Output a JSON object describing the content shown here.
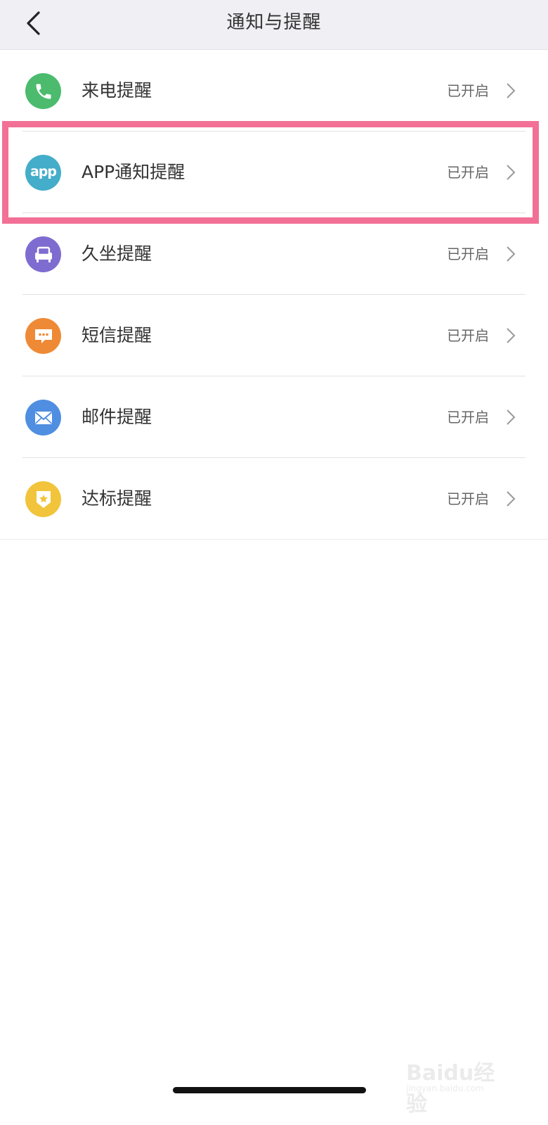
{
  "nav": {
    "title": "通知与提醒"
  },
  "rows": [
    {
      "label": "来电提醒",
      "status": "已开启",
      "icon": "phone-icon",
      "color": "#4cbb6e"
    },
    {
      "label": "APP通知提醒",
      "status": "已开启",
      "icon": "app-icon",
      "color": "#44adc9",
      "icon_text": "app"
    },
    {
      "label": "久坐提醒",
      "status": "已开启",
      "icon": "sofa-icon",
      "color": "#7f6cd1"
    },
    {
      "label": "短信提醒",
      "status": "已开启",
      "icon": "message-icon",
      "color": "#ee8a35"
    },
    {
      "label": "邮件提醒",
      "status": "已开启",
      "icon": "mail-icon",
      "color": "#4f8ee0"
    },
    {
      "label": "达标提醒",
      "status": "已开启",
      "icon": "badge-star-icon",
      "color": "#f2c43c"
    }
  ],
  "watermark": {
    "brand": "Baidu经验",
    "url": "jingyan.baidu.com"
  }
}
